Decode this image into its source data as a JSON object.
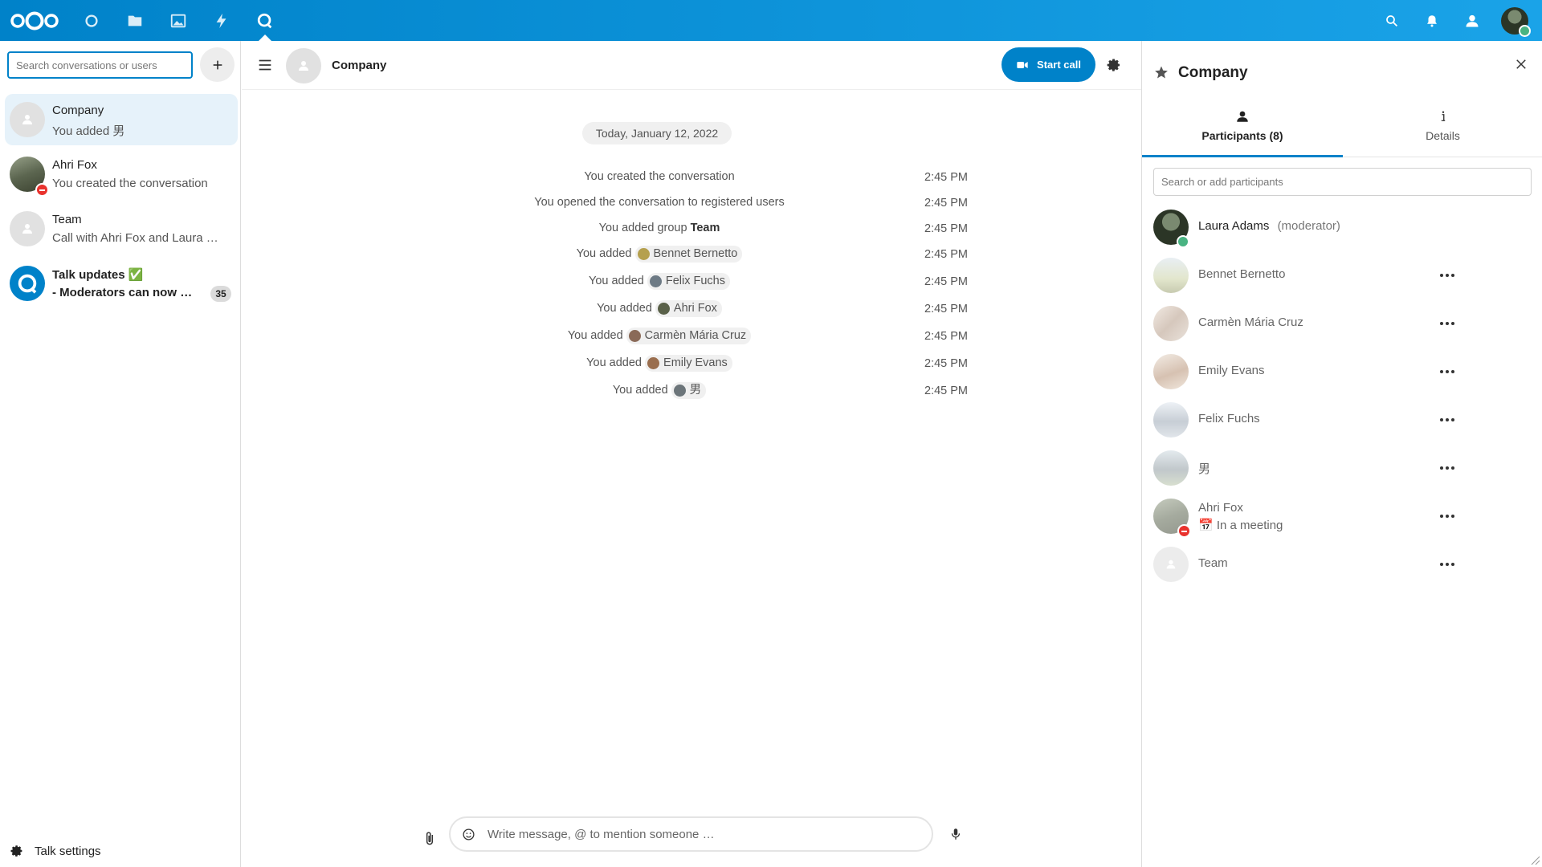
{
  "app": {
    "top_icons": [
      "nextcloud-logo",
      "dashboard-icon",
      "files-icon",
      "photos-icon",
      "activity-icon",
      "talk-icon"
    ],
    "right_icons": [
      "search-icon",
      "notifications-icon",
      "contacts-icon",
      "user-avatar"
    ],
    "accent": "#0082c9"
  },
  "left": {
    "search_placeholder": "Search conversations or users",
    "conversations": [
      {
        "name": "Company",
        "preview": "You added 男",
        "active": true
      },
      {
        "name": "Ahri Fox",
        "preview": "You created the conversation",
        "status": "do-not-disturb"
      },
      {
        "name": "Team",
        "preview": "Call with Ahri Fox and Laura …"
      },
      {
        "name": "Talk updates ✅",
        "preview": "- Moderators can now as…",
        "unread": "35"
      }
    ],
    "settings_label": "Talk settings"
  },
  "main": {
    "title": "Company",
    "start_call": "Start call",
    "date": "Today, January 12, 2022",
    "messages": [
      {
        "prefix": "You created the conversation",
        "time": "2:45 PM"
      },
      {
        "prefix": "You opened the conversation to registered users",
        "time": "2:45 PM"
      },
      {
        "prefix": "You added group ",
        "bold": "Team",
        "time": "2:45 PM"
      },
      {
        "prefix": "You added ",
        "chip": "Bennet Bernetto",
        "time": "2:45 PM"
      },
      {
        "prefix": "You added ",
        "chip": "Felix Fuchs",
        "time": "2:45 PM"
      },
      {
        "prefix": "You added ",
        "chip": "Ahri Fox",
        "time": "2:45 PM"
      },
      {
        "prefix": "You added ",
        "chip": "Carmèn Mária Cruz",
        "time": "2:45 PM"
      },
      {
        "prefix": "You added ",
        "chip": "Emily Evans",
        "time": "2:45 PM"
      },
      {
        "prefix": "You added ",
        "chip": "男",
        "time": "2:45 PM"
      }
    ],
    "composer_placeholder": "Write message, @ to mention someone …"
  },
  "sidebar": {
    "title": "Company",
    "tabs": {
      "participants": "Participants (8)",
      "details": "Details"
    },
    "search_placeholder": "Search or add participants",
    "participants": [
      {
        "name": "Laura Adams",
        "role": "(moderator)",
        "status": "online"
      },
      {
        "name": "Bennet Bernetto",
        "offline": true
      },
      {
        "name": "Carmèn Mária Cruz",
        "offline": true
      },
      {
        "name": "Emily Evans",
        "offline": true
      },
      {
        "name": "Felix Fuchs",
        "offline": true
      },
      {
        "name": "男",
        "offline": true
      },
      {
        "name": "Ahri Fox",
        "status_text": "📅 In a meeting",
        "offline": true
      },
      {
        "name": "Team",
        "offline": true
      }
    ]
  }
}
